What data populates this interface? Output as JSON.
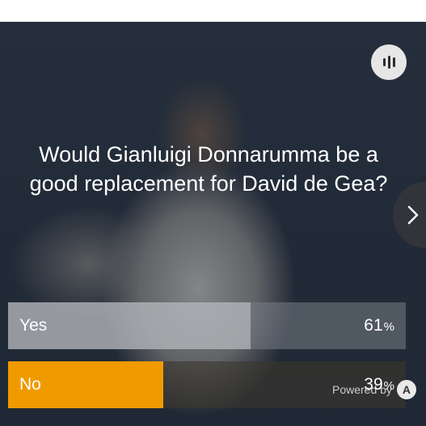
{
  "poll": {
    "question": "Would Gianluigi Donnarumma be a good replacement for David de Gea?",
    "options": [
      {
        "label": "Yes",
        "percent": "61",
        "unit": "%",
        "share": 0.61
      },
      {
        "label": "No",
        "percent": "39",
        "unit": "%",
        "share": 0.39
      }
    ]
  },
  "footer": {
    "powered_by": "Powered by",
    "logo_letter": "A"
  },
  "icons": {
    "stats": "stats-icon",
    "next": "chevron-right-icon",
    "brand": "brand-logo-icon"
  },
  "colors": {
    "selected_fill": "#f09a00"
  }
}
